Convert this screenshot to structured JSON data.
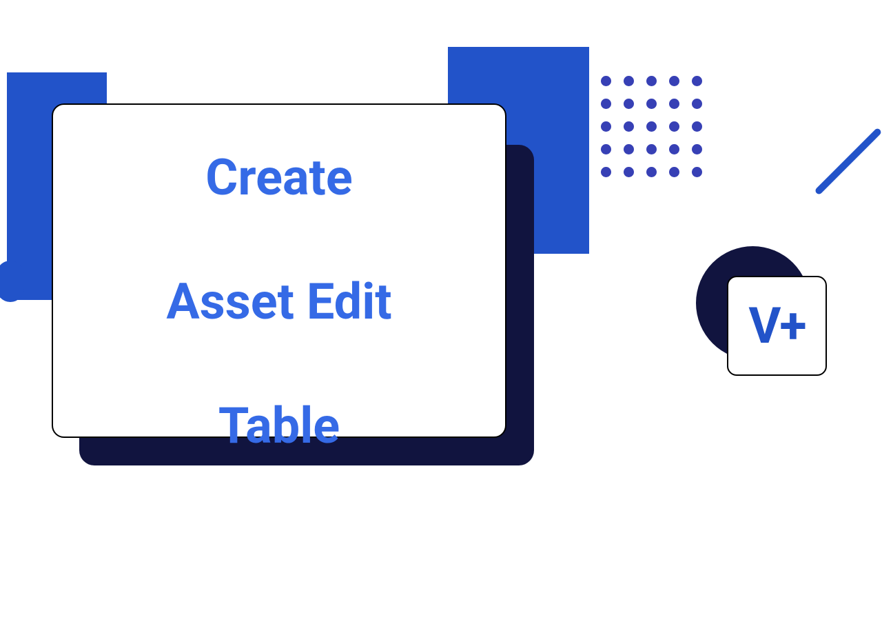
{
  "main": {
    "title_line1": "Create",
    "title_line2": "Asset Edit",
    "title_line3": "Table"
  },
  "badge": {
    "label": "V+"
  },
  "colors": {
    "primary_blue": "#2253c9",
    "text_blue": "#356ae6",
    "dark_navy": "#11143f",
    "dot_purple": "#3740b5"
  }
}
